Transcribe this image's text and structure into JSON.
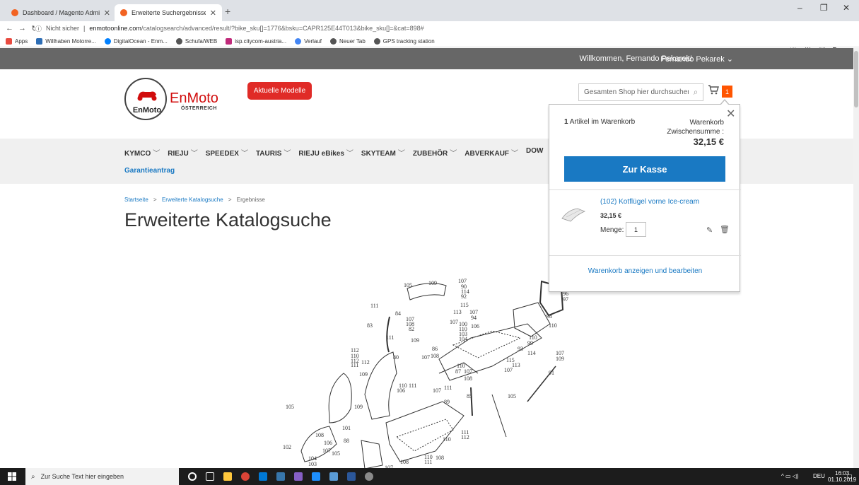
{
  "browser": {
    "tabs": [
      {
        "title": "Dashboard / Magento Admin",
        "active": false
      },
      {
        "title": "Erweiterte Suchergebnisse",
        "active": true
      }
    ],
    "security_label": "Nicht sicher",
    "url_host": "enmotoonline.com",
    "url_path": "/catalogsearch/advanced/result/?bike_sku[]=1776&bsku=CAPR125E44T013&bike_sku[]=&cat=898#",
    "bookmarks": [
      {
        "label": "Apps",
        "color": "#e84a3f"
      },
      {
        "label": "Willhaben Motorre...",
        "color": "#2d6db5"
      },
      {
        "label": "DigitalOcean - Enm...",
        "color": "#0080ff"
      },
      {
        "label": "Schufa/WEB",
        "color": "#555555"
      },
      {
        "label": "isp.citycom-austria...",
        "color": "#c02a7a"
      },
      {
        "label": "Verlauf",
        "color": "#4285f4"
      },
      {
        "label": "Neuer Tab",
        "color": "#555555"
      },
      {
        "label": "GPS tracking station",
        "color": "#555555"
      }
    ]
  },
  "header": {
    "welcome": "Willkommen, Fernando Pekarek!",
    "account": "Fernando Pekarek",
    "logo_brand": "EnMoto",
    "logo_sub": "ÖSTERREICH",
    "logo_circle_text": "EnMoto",
    "promo_button": "Aktuelle Modelle",
    "search_placeholder": "Gesamten Shop hier durchsuchen...",
    "cart_count": "1"
  },
  "nav": {
    "items": [
      "KYMCO",
      "RIEJU",
      "SPEEDEX",
      "TAURIS",
      "RIEJU eBikes",
      "SKYTEAM",
      "ZUBEHÖR",
      "ABVERKAUF",
      "DOW"
    ],
    "second_row": "Garantieantrag"
  },
  "breadcrumb": {
    "home": "Startseite",
    "search": "Erweiterte Katalogsuche",
    "current": "Ergebnisse"
  },
  "page_title": "Erweiterte Katalogsuche",
  "minicart": {
    "count_number": "1",
    "count_text": "Artikel im Warenkorb",
    "subtotal_label": "Warenkorb Zwischensumme :",
    "subtotal": "32,15 €",
    "checkout_button": "Zur Kasse",
    "item_name": "(102) Kotflügel vorne Ice-cream",
    "item_price": "32,15 €",
    "qty_label": "Menge:",
    "qty_value": "1",
    "view_cart": "Warenkorb anzeigen und bearbeiten"
  },
  "diagram_labels": [
    "105",
    "109",
    "107",
    "90",
    "114",
    "92",
    "111",
    "84",
    "107",
    "108",
    "115",
    "113",
    "107",
    "82",
    "109",
    "107",
    "106",
    "94",
    "110",
    "103",
    "104",
    "98",
    "83",
    "111",
    "100",
    "110",
    "96",
    "97",
    "112",
    "110",
    "112",
    "80",
    "86",
    "107",
    "108",
    "93",
    "114",
    "99",
    "109",
    "107",
    "110",
    "111",
    "112",
    "110",
    "111",
    "115",
    "113",
    "107",
    "87",
    "91",
    "107",
    "110",
    "111",
    "108",
    "109",
    "106",
    "107",
    "89",
    "85",
    "105",
    "105",
    "109",
    "101",
    "88",
    "110",
    "111",
    "112",
    "102",
    "106",
    "108",
    "107",
    "105",
    "104",
    "103",
    "107",
    "108",
    "108",
    "111",
    "110"
  ],
  "taskbar": {
    "search_placeholder": "Zur Suche Text hier eingeben",
    "lang": "DEU",
    "time": "16:03",
    "date": "01.10.2019"
  },
  "colors": {
    "accent_blue": "#1979c3",
    "promo_red": "#e02b27",
    "cart_badge": "#ff5501",
    "topbar": "#676767"
  }
}
